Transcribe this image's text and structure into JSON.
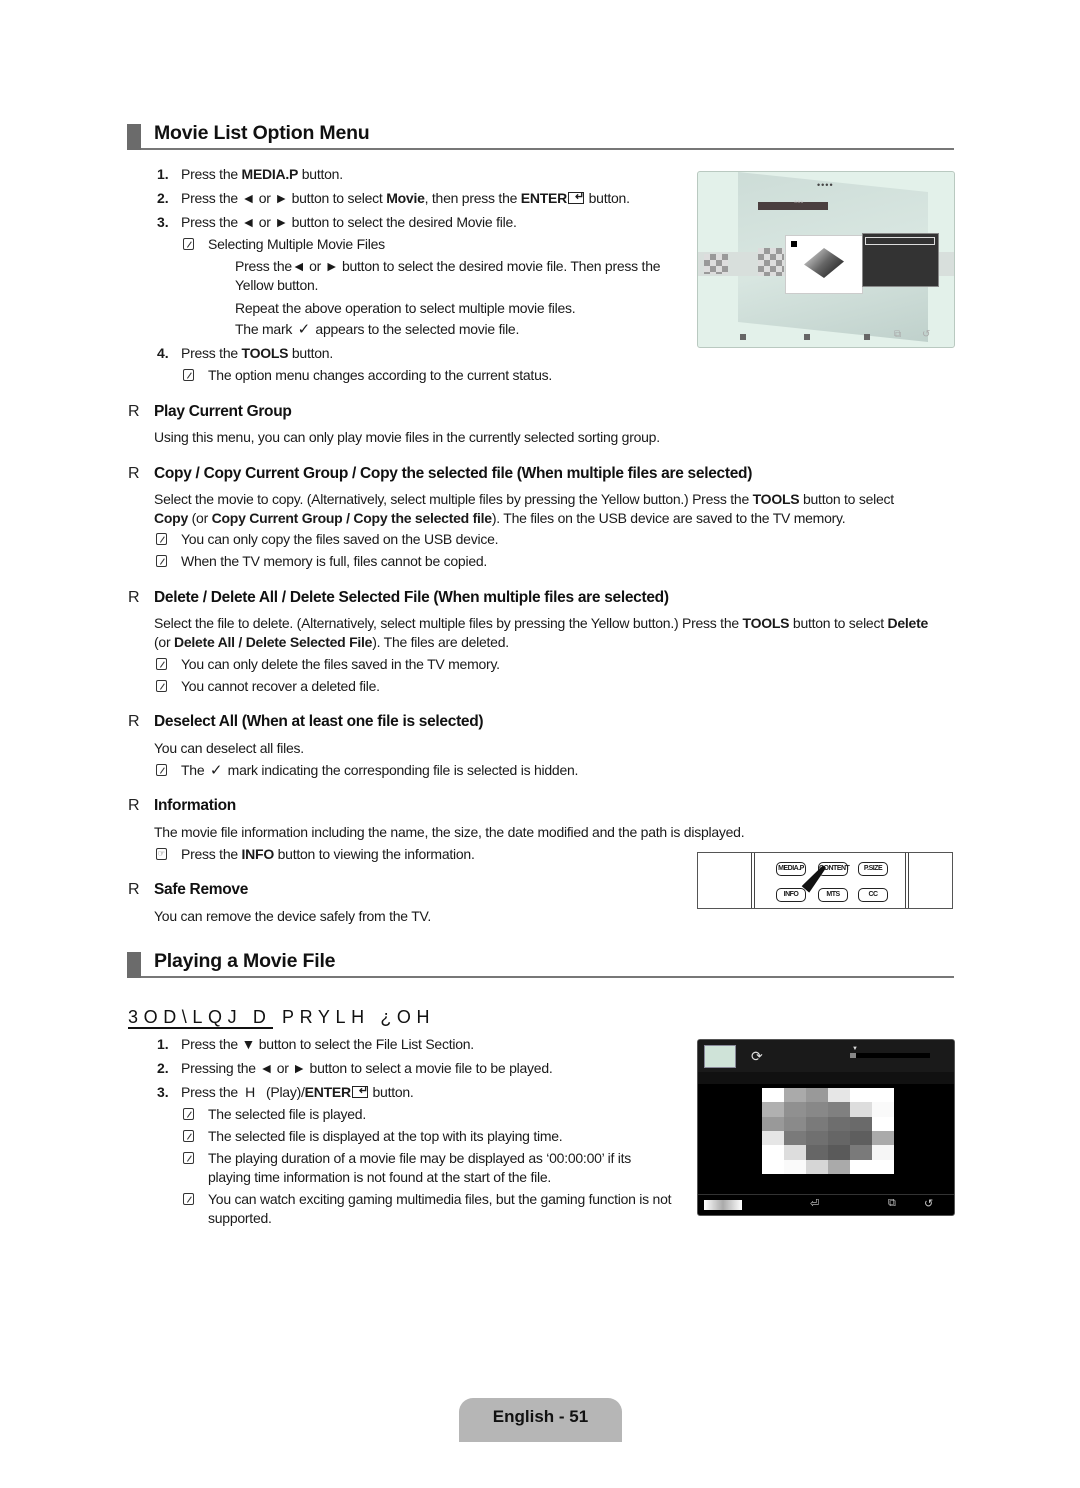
{
  "section1": {
    "title": "Movie List Option Menu",
    "steps": [
      {
        "num": "1.",
        "pre": "Press the ",
        "bold": "MEDIA.P",
        "post": " button."
      },
      {
        "num": "2.",
        "pre": "Press the ◄ or ► button to select ",
        "bold": "Movie",
        "mid": ", then press the ",
        "bold2": "ENTER",
        "post": " button."
      },
      {
        "num": "3.",
        "text": "Press the ◄ or ► button to select the desired Movie file."
      },
      {
        "num": "4.",
        "pre": "Press the ",
        "bold": "TOOLS",
        "post": " button."
      }
    ],
    "note_multi_title": "Selecting Multiple Movie Files",
    "multi_line1": "Press the◄ or ► button to select the desired movie file. Then press the",
    "multi_line2": "Yellow button.",
    "multi_line3": "Repeat the above operation to select multiple movie files.",
    "multi_line4_pre": "The mark",
    "multi_line4_post": "appears to the selected movie file.",
    "check_glyph": "✓",
    "note_option": "The option menu changes according to the current status."
  },
  "options": [
    {
      "bullet": "R",
      "title": "Play Current Group",
      "body": "Using this menu, you can only play movie files in the currently selected sorting group."
    },
    {
      "bullet": "R",
      "title": "Copy / Copy Current Group / Copy the selected file (When multiple files are selected)",
      "body1_pre": "Select the movie to copy. (Alternatively, select multiple files by pressing the Yellow button.) Press the ",
      "body1_bold": "TOOLS",
      "body1_post": " button to select",
      "body2_b1": "Copy",
      "body2_mid": " (or ",
      "body2_b2": "Copy Current Group / Copy the selected file",
      "body2_post": "). The files on the USB device are saved to the TV memory.",
      "notes": [
        "You can only copy the files saved on the USB device.",
        "When the TV memory is full, files cannot be copied."
      ]
    },
    {
      "bullet": "R",
      "title": "Delete / Delete All / Delete Selected File (When multiple files are selected)",
      "body1_pre": "Select the file to delete. (Alternatively, select multiple files by pressing the Yellow button.) Press the ",
      "body1_bold": "TOOLS",
      "body1_mid": " button to select ",
      "body1_bold2": "Delete",
      "body2_pre": "(or ",
      "body2_bold": "Delete All / Delete Selected File",
      "body2_post": "). The files are deleted.",
      "notes": [
        "You can only delete the files saved in the TV memory.",
        "You cannot recover a deleted file."
      ]
    },
    {
      "bullet": "R",
      "title": "Deselect All (When at least one file is selected)",
      "body": "You can deselect all files.",
      "note_pre": "The",
      "note_post": "mark indicating the corresponding file is selected is hidden."
    },
    {
      "bullet": "R",
      "title": "Information",
      "body": "The movie file information including the name, the size, the date modified and the path is displayed.",
      "note_pre": "Press the ",
      "note_bold": "INFO",
      "note_post": " button to viewing the information."
    },
    {
      "bullet": "R",
      "title": "Safe Remove",
      "body": "You can remove the device safely from the TV."
    }
  ],
  "remote": {
    "buttons_row1": [
      "MEDIA.P",
      "CONTENT",
      "P.SIZE"
    ],
    "buttons_row2": [
      "INFO",
      "MTS",
      "CC"
    ]
  },
  "section2": {
    "title": "Playing a Movie File",
    "subheading": "3OD\\LQJ D PRYLH ¿OH",
    "steps": [
      {
        "num": "1.",
        "text": "Press the ▼ button to select the File List Section."
      },
      {
        "num": "2.",
        "text": "Pressing the ◄ or ► button to select a movie file to be played."
      },
      {
        "num": "3.",
        "pre": "Press the  H   (Play)/",
        "bold": "ENTER",
        "post": " button."
      }
    ],
    "notes": [
      "The selected file is played.",
      "The selected file is displayed at the top with its playing time.",
      "The playing duration of a movie file may be displayed as ‘00:00:00’ if its",
      "playing time information is not found at the start of the file.",
      "You can watch exciting gaming multimedia files, but the gaming function is not",
      "supported."
    ]
  },
  "footer": {
    "page_label": "English - 51"
  },
  "colors": {
    "heading_bar": "#6b6b6b",
    "page_tab": "#b6b6b6",
    "screen1_bg": "#e3f1ea"
  }
}
